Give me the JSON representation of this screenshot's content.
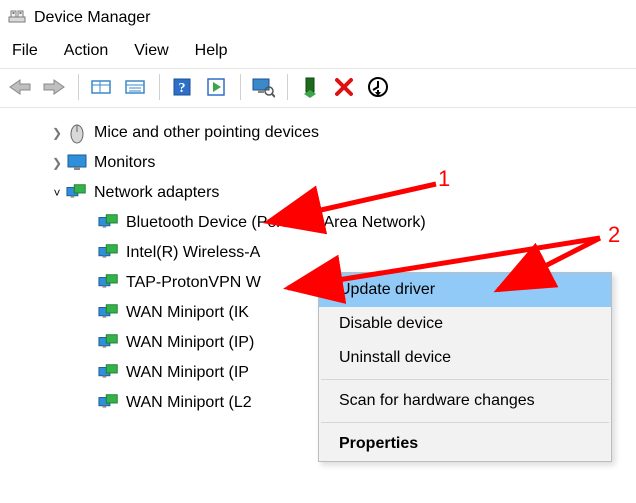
{
  "window": {
    "title": "Device Manager"
  },
  "menubar": [
    "File",
    "Action",
    "View",
    "Help"
  ],
  "tree": {
    "mice": "Mice and other pointing devices",
    "monitors": "Monitors",
    "network": "Network adapters",
    "net_items": [
      "Bluetooth Device (Personal Area Network)",
      "Intel(R) Wireless-A",
      "TAP-ProtonVPN W",
      "WAN Miniport (IK",
      "WAN Miniport (IP)",
      "WAN Miniport (IP",
      "WAN Miniport (L2"
    ]
  },
  "context_menu": {
    "update": "Update driver",
    "disable": "Disable device",
    "uninstall": "Uninstall device",
    "scan": "Scan for hardware changes",
    "properties": "Properties"
  },
  "annotations": {
    "one": "1",
    "two": "2"
  }
}
